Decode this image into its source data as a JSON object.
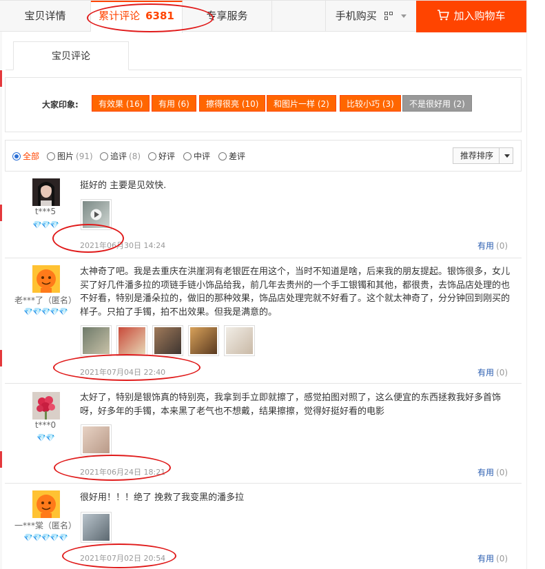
{
  "tabs": {
    "details": "宝贝详情",
    "reviews_label": "累计评论",
    "reviews_count": "6381",
    "service": "专享服务",
    "mobile_buy": "手机购买",
    "cart": "加入购物车"
  },
  "inner_tab": "宝贝评论",
  "impressions": {
    "label": "大家印象:",
    "tags": [
      {
        "text": "有效果 (16)"
      },
      {
        "text": "有用 (6)"
      },
      {
        "text": "擦得很亮 (10)"
      },
      {
        "text": "和图片一样 (2)"
      },
      {
        "text": "比较小巧 (3)"
      },
      {
        "text": "不是很好用 (2)"
      }
    ]
  },
  "filters": {
    "all": "全部",
    "pics": "图片",
    "pics_count": "(91)",
    "append": "追评",
    "append_count": "(8)",
    "good": "好评",
    "mid": "中评",
    "bad": "差评",
    "sort": "推荐排序"
  },
  "reviews": [
    {
      "nick": "t***5",
      "gems": "💎💎💎",
      "text": "挺好的 主要是见效快.",
      "date": "2021年06月30日 14:24",
      "useful": "有用",
      "useful_count": "(0)"
    },
    {
      "nick": "老***了（匿名）",
      "gems": "💎💎💎💎💎",
      "text": "太神奇了吧。我是去重庆在洪崖洞有老银匠在用这个，当时不知道是啥，后来我的朋友提起。银饰很多，女儿买了好几件潘多拉的项链手链小饰品给我，前几年去贵州的一个手工银镯和其他，都很贵，去饰品店处理的也不好看，特别是潘朵拉的，做旧的那种效果，饰品店处理完就不好看了。这个就太神奇了，分分钟回到刚买的样子。只拍了手镯，拍不出效果。但我是满意的。",
      "date": "2021年07月04日 22:40",
      "useful": "有用",
      "useful_count": "(0)"
    },
    {
      "nick": "t***0",
      "gems": "💎💎",
      "text": "太好了，特别是银饰真的特别亮，我拿到手立即就擦了，感觉拍图对照了，这么便宜的东西拯救我好多首饰呀，好多年的手镯，本来黑了老气也不想戴，结果擦擦，觉得好挺好看的电影",
      "date": "2021年06月24日 18:21",
      "useful": "有用",
      "useful_count": "(0)"
    },
    {
      "nick": "一***棠（匿名）",
      "gems": "💎💎💎💎💎",
      "text": "很好用！！！绝了 挽救了我变黑的潘多拉",
      "date": "2021年07月02日 20:54",
      "useful": "有用",
      "useful_count": "(0)"
    }
  ],
  "colors": {
    "accent": "#ff4400",
    "tag_orange": "#ff6600",
    "link_blue": "#2a5db0",
    "annotation_red": "#e01a1a"
  }
}
